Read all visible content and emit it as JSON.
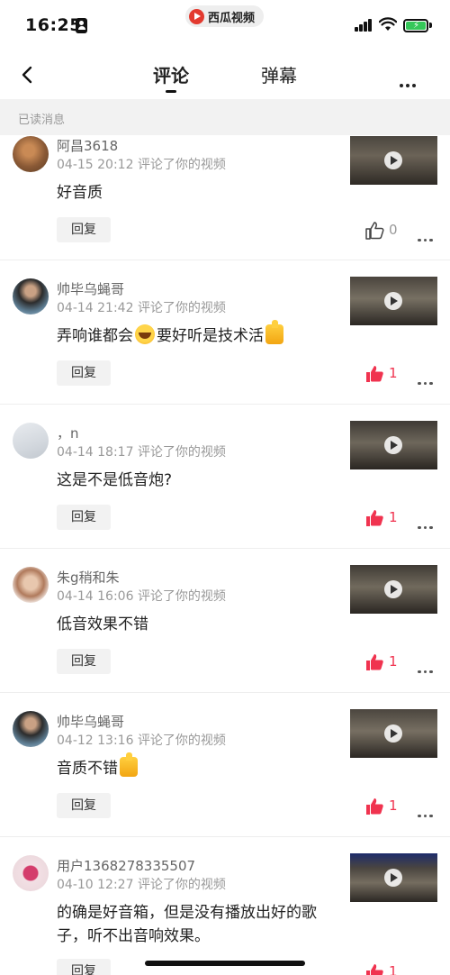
{
  "status_bar": {
    "time": "16:25",
    "app_name": "西瓜视频"
  },
  "nav": {
    "tab_comments": "评论",
    "tab_danmaku": "弹幕"
  },
  "section": {
    "title": "已读消息"
  },
  "items": [
    {
      "username": "阿昌3618",
      "date": "04-15 20:12",
      "action": "评论了你的视频",
      "comment": "好音质",
      "reply_label": "回复",
      "likes": "0",
      "liked": false
    },
    {
      "username": "帅毕乌蝇哥",
      "date": "04-14 21:42",
      "action": "评论了你的视频",
      "comment_a": "弄响谁都会",
      "comment_b": "要好听是技术活",
      "reply_label": "回复",
      "likes": "1",
      "liked": true
    },
    {
      "username": "，n",
      "date": "04-14 18:17",
      "action": "评论了你的视频",
      "comment": "这是不是低音炮?",
      "reply_label": "回复",
      "likes": "1",
      "liked": true
    },
    {
      "username": "朱g稍和朱",
      "date": "04-14 16:06",
      "action": "评论了你的视频",
      "comment": "低音效果不错",
      "reply_label": "回复",
      "likes": "1",
      "liked": true
    },
    {
      "username": "帅毕乌蝇哥",
      "date": "04-12 13:16",
      "action": "评论了你的视频",
      "comment": "音质不错",
      "reply_label": "回复",
      "likes": "1",
      "liked": true
    },
    {
      "username": "用户1368278335507",
      "date": "04-10 12:27",
      "action": "评论了你的视频",
      "comment": "的确是好音箱，但是没有播放出好的歌子，听不出音响效果。",
      "reply_label": "回复",
      "likes": "1",
      "liked": true
    }
  ],
  "colors": {
    "accent_red": "#f0334f",
    "muted": "#999999",
    "brand": "#e33a2f"
  }
}
